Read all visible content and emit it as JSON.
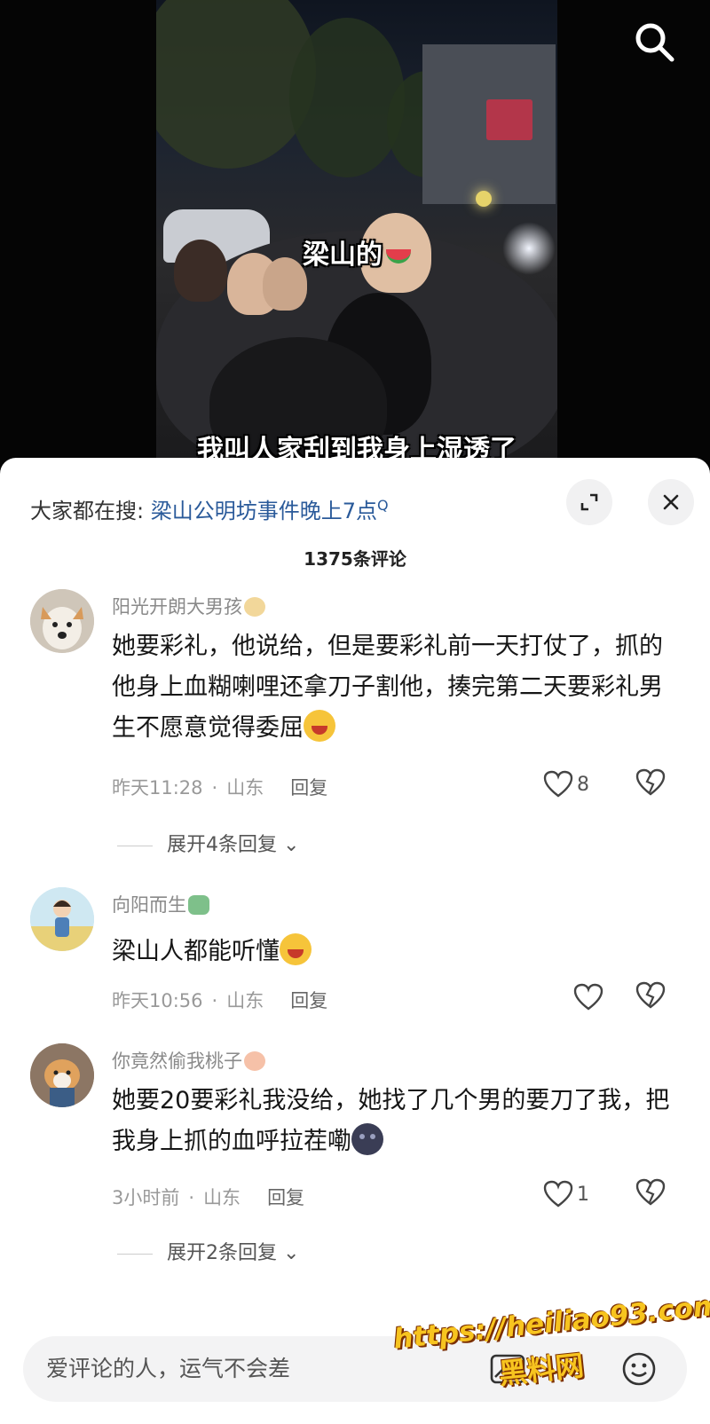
{
  "video": {
    "caption_top": "梁山的",
    "caption_bottom": "我叫人家刮到我身上湿透了",
    "search_icon": "search-icon"
  },
  "sheet": {
    "search_prefix": "大家都在搜:",
    "search_query": "梁山公明坊事件晚上7点",
    "search_glyph": "Q",
    "expand_icon": "expand-icon",
    "close_icon": "close-icon",
    "comment_count": "1375条评论"
  },
  "comments": [
    {
      "username": "阳光开朗大男孩",
      "text": "她要彩礼，他说给，但是要彩礼前一天打仗了，抓的他身上血糊喇哩还拿刀子割他，揍完第二天要彩礼男生不愿意觉得委屈",
      "time": "昨天11:28",
      "location": "山东",
      "reply_label": "回复",
      "likes": "8",
      "expand_replies": "展开4条回复"
    },
    {
      "username": "向阳而生",
      "text": "梁山人都能听懂",
      "time": "昨天10:56",
      "location": "山东",
      "reply_label": "回复",
      "likes": ""
    },
    {
      "username": "你竟然偷我桃子",
      "text": "她要20要彩礼我没给，她找了几个男的要刀了我，把我身上抓的血呼拉茬嘞",
      "time": "3小时前",
      "location": "山东",
      "reply_label": "回复",
      "likes": "1",
      "expand_replies": "展开2条回复"
    }
  ],
  "input": {
    "placeholder": "爱评论的人，运气不会差",
    "image_icon": "image-icon",
    "emoji_icon": "smile-icon"
  },
  "watermark": {
    "url": "https://heiliao93.com",
    "name": "黑料网"
  },
  "colors": {
    "link_blue": "#2a5a9a",
    "meta_gray": "#999999",
    "watermark_yellow": "#f7c41f"
  }
}
